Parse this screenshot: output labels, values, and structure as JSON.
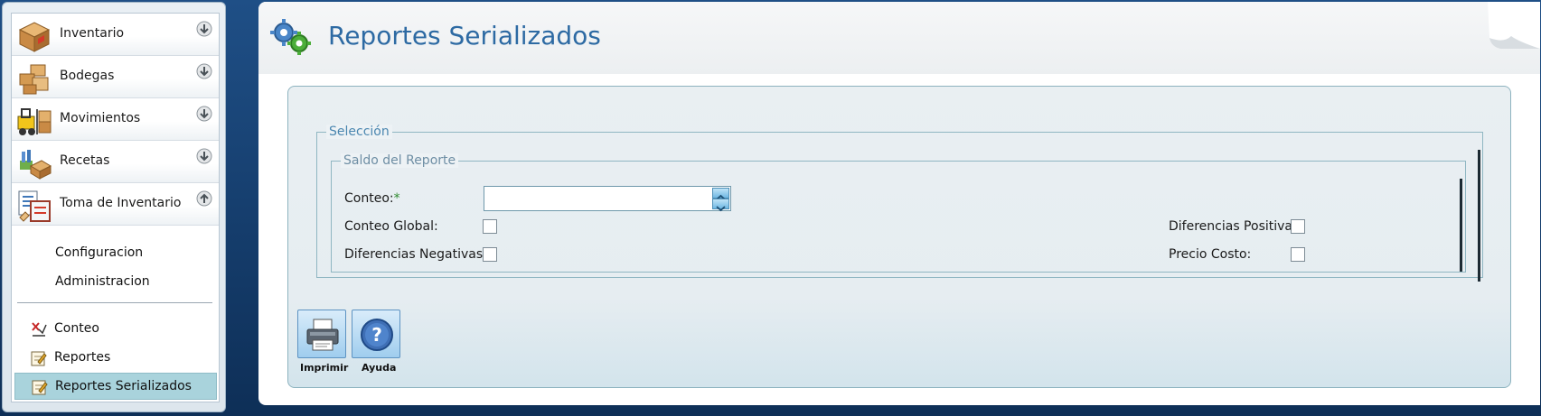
{
  "sidebar": {
    "sections": [
      {
        "label": "Inventario",
        "icon": "box-icon",
        "expanded": false
      },
      {
        "label": "Bodegas",
        "icon": "boxes-icon",
        "expanded": false
      },
      {
        "label": "Movimientos",
        "icon": "forklift-icon",
        "expanded": false
      },
      {
        "label": "Recetas",
        "icon": "flask-box-icon",
        "expanded": false
      },
      {
        "label": "Toma de Inventario",
        "icon": "clipboard-icon",
        "expanded": true
      }
    ],
    "sub_items": [
      "Configuracion",
      "Administracion"
    ],
    "nav_items": [
      {
        "label": "Conteo",
        "icon": "count-icon"
      },
      {
        "label": "Reportes",
        "icon": "report-edit-icon"
      },
      {
        "label": "Reportes Serializados",
        "icon": "report-edit-icon",
        "active": true
      }
    ]
  },
  "page": {
    "title": "Reportes Serializados"
  },
  "form": {
    "outer_legend": "Selección",
    "inner_legend": "Saldo del Reporte",
    "conteo_label": "Conteo:",
    "required_mark": "*",
    "conteo_value": "",
    "conteo_global_label": "Conteo Global:",
    "diferencias_negativas_label": "Diferencias Negativas:",
    "diferencias_positivas_label": "Diferencias Positivas:",
    "precio_costo_label": "Precio Costo:",
    "checks": {
      "conteo_global": false,
      "diferencias_negativas": false,
      "diferencias_positivas": false,
      "precio_costo": false
    }
  },
  "toolbar": {
    "print_label": "Imprimir",
    "help_label": "Ayuda"
  },
  "colors": {
    "accent": "#2d6aa3",
    "active_nav": "#a9d3dc",
    "required": "#2f8b2f"
  }
}
